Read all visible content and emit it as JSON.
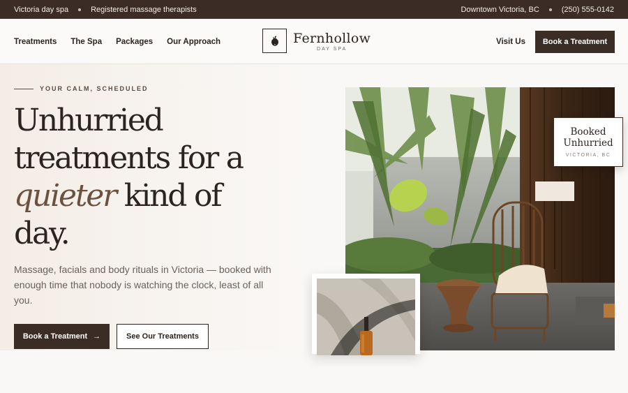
{
  "topbar": {
    "left_1": "Victoria day spa",
    "left_2": "Registered massage therapists",
    "right_1": "Downtown Victoria, BC",
    "right_2": "(250) 555-0142"
  },
  "nav": {
    "links": [
      "Treatments",
      "The Spa",
      "Packages",
      "Our Approach"
    ],
    "visit": "Visit Us",
    "cta": "Book a Treatment"
  },
  "logo": {
    "name": "Fernhollow",
    "sub": "DAY SPA"
  },
  "hero": {
    "eyebrow": "YOUR CALM, SCHEDULED",
    "headline_1": "Unhurried",
    "headline_2": "treatments for a",
    "headline_emph": "quieter",
    "headline_3": " kind of",
    "headline_4": "day.",
    "lede": "Massage, facials and body rituals in Victoria — booked with enough time that nobody is watching the clock, least of all you.",
    "primary_button": "Book a Treatment",
    "primary_arrow": "→",
    "secondary_button": "See Our Treatments"
  },
  "badge": {
    "title_1": "Booked",
    "title_2": "Unhurried",
    "sub": "VICTORIA, BC"
  },
  "colors": {
    "brand_dark": "#3b2d25",
    "accent_italic": "#6b5240",
    "background": "#faf8f6"
  },
  "icons": {
    "logo": "fern-mark-icon",
    "arrow": "arrow-right-icon"
  }
}
